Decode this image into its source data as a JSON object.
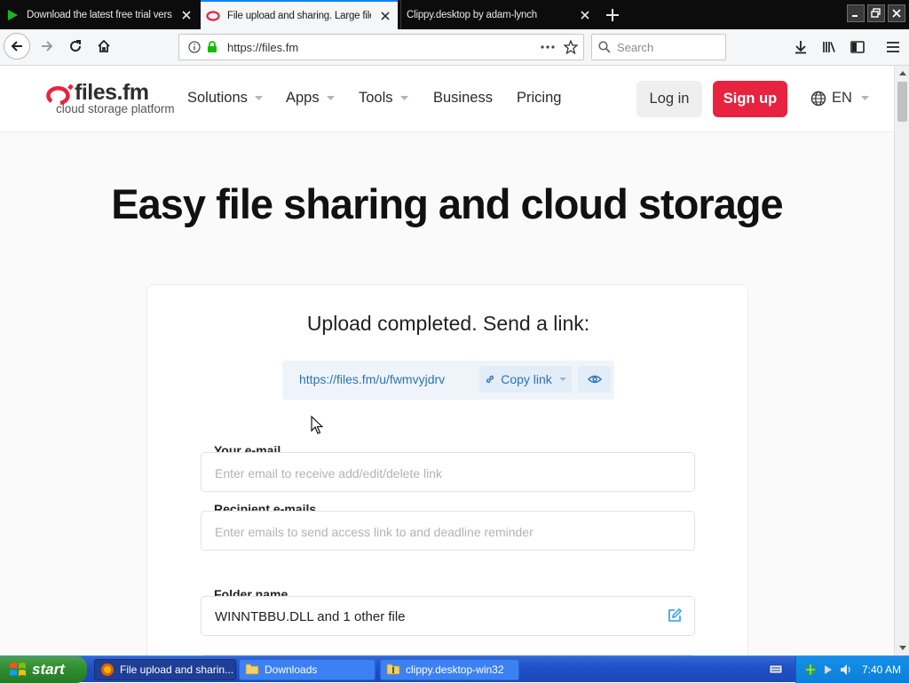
{
  "browser": {
    "tabs": [
      {
        "title": "Download the latest free trial vers",
        "active": false
      },
      {
        "title": "File upload and sharing. Large file",
        "active": true
      },
      {
        "title": "Clippy.desktop by adam-lynch",
        "active": false
      }
    ],
    "url": "https://files.fm",
    "search_placeholder": "Search"
  },
  "site": {
    "logo_name": "files.fm",
    "logo_tagline": "cloud storage platform",
    "nav": [
      {
        "label": "Solutions",
        "dropdown": true
      },
      {
        "label": "Apps",
        "dropdown": true
      },
      {
        "label": "Tools",
        "dropdown": true
      },
      {
        "label": "Business",
        "dropdown": false
      },
      {
        "label": "Pricing",
        "dropdown": false
      }
    ],
    "login_label": "Log in",
    "signup_label": "Sign up",
    "language": "EN",
    "brand_color": "#e8233f"
  },
  "main": {
    "hero_title": "Easy file sharing and cloud storage",
    "status": "Upload completed. Send a link:",
    "share_link": "https://files.fm/u/fwmvyjdrv",
    "copy_label": "Copy link",
    "email_label": "Your e-mail",
    "email_placeholder": "Enter email to receive add/edit/delete link",
    "recipients_label": "Recipient e-mails",
    "recipients_placeholder": "Enter emails to send access link to and deadline reminder",
    "folder_label": "Folder name",
    "folder_value": "WINNTBBU.DLL and 1 other file"
  },
  "taskbar": {
    "start_label": "start",
    "tasks": [
      {
        "label": "File upload and sharin...",
        "active": true
      },
      {
        "label": "Downloads",
        "active": false
      },
      {
        "label": "clippy.desktop-win32",
        "active": false
      }
    ],
    "clock": "7:40 AM"
  }
}
